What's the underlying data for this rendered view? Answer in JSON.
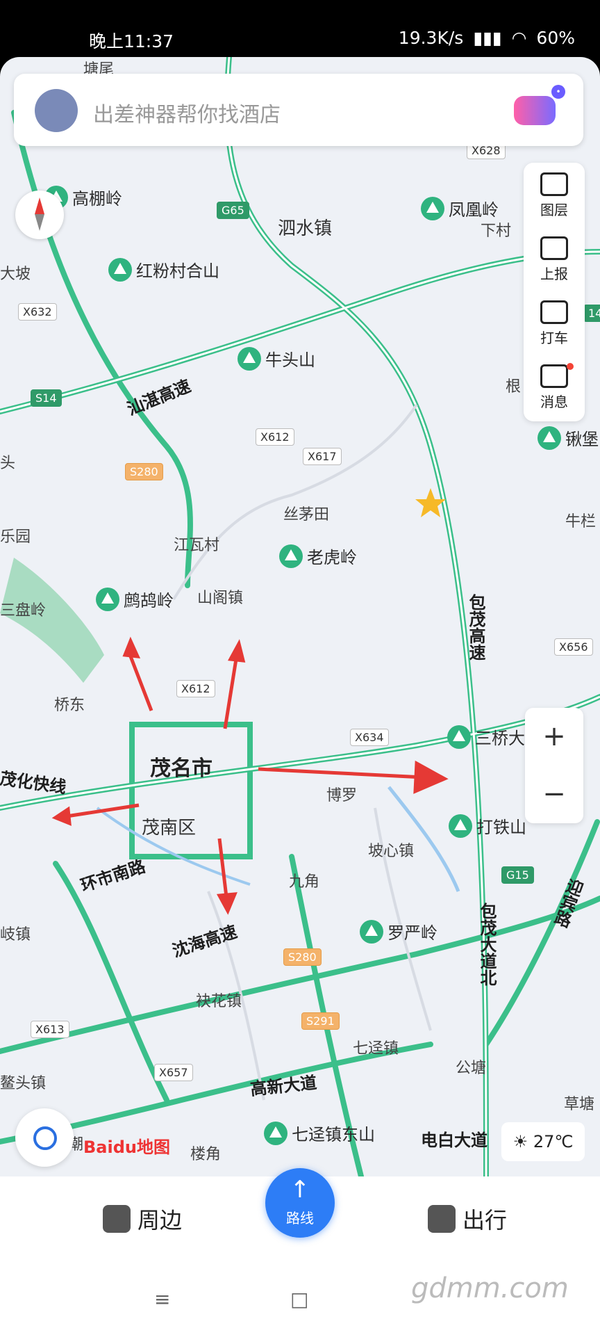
{
  "status_bar": {
    "time": "晚上11:37",
    "network_speed": "19.3K/s",
    "battery": "60%"
  },
  "search": {
    "placeholder": "出差神器帮你找酒店"
  },
  "toolbar": {
    "items": [
      {
        "label": "图层",
        "icon": "layers-icon"
      },
      {
        "label": "上报",
        "icon": "report-icon"
      },
      {
        "label": "打车",
        "icon": "taxi-icon"
      },
      {
        "label": "消息",
        "icon": "message-icon",
        "badge": true
      }
    ]
  },
  "map": {
    "city": "茂名市",
    "district": "茂南区",
    "places": [
      "高棚岭",
      "泗水镇",
      "凤凰岭",
      "下村",
      "大坡",
      "红粉村合山",
      "牛头山",
      "根",
      "锹堡",
      "头",
      "丝茅田",
      "牛栏",
      "乐园",
      "江瓦村",
      "老虎岭",
      "三盘岭",
      "鹧鸪岭",
      "山阁镇",
      "桥东",
      "博罗",
      "三桥大岭",
      "打铁山",
      "坡心镇",
      "九角",
      "罗严岭",
      "岐镇",
      "袂花镇",
      "七迳镇",
      "公塘",
      "鳌头镇",
      "草塘",
      "潮",
      "楼角",
      "七迳镇东山",
      "塘尾"
    ],
    "roads": [
      "汕湛高速",
      "包茂高速",
      "茂化快线",
      "环市南路",
      "沈海高速",
      "包茂大道北",
      "迎宾路",
      "高新大道",
      "电白大道"
    ],
    "shields": [
      "G65",
      "X632",
      "S14",
      "S280",
      "X612",
      "X617",
      "X612",
      "X656",
      "X634",
      "G15",
      "S280",
      "S291",
      "X613",
      "X657",
      "X628",
      "14"
    ]
  },
  "zoom": {
    "in": "+",
    "out": "−"
  },
  "logo": "Baidu地图",
  "weather": {
    "temp": "27℃"
  },
  "bottom_nav": {
    "nearby": "周边",
    "route": "路线",
    "travel": "出行"
  },
  "watermark": "gdmm.com",
  "colors": {
    "road": "#3bbf8a",
    "arrow": "#e53935",
    "primary": "#2d7df6"
  }
}
